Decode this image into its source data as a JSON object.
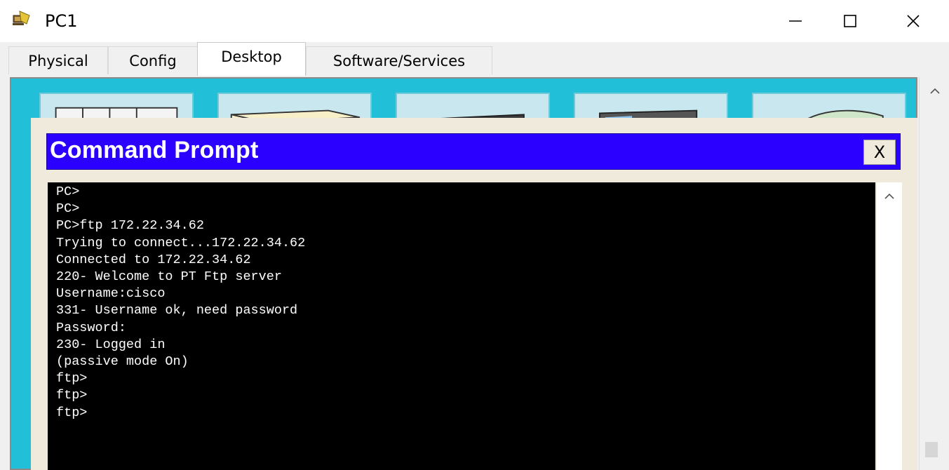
{
  "window": {
    "title": "PC1",
    "icon": "pc-device-icon",
    "controls": [
      "minimize-icon",
      "maximize-icon",
      "close-icon"
    ]
  },
  "tabs": [
    {
      "label": "Physical",
      "active": false
    },
    {
      "label": "Config",
      "active": false
    },
    {
      "label": "Desktop",
      "active": true
    },
    {
      "label": "Software/Services",
      "active": false
    }
  ],
  "colors": {
    "desktop_bg": "#22c0d8",
    "cmd_title_bg": "#2b00ff",
    "terminal_bg": "#000000",
    "terminal_fg": "#ffffff"
  },
  "command_prompt": {
    "title": "Command Prompt",
    "close_label": "X",
    "lines": [
      "PC>",
      "PC>",
      "PC>ftp 172.22.34.62",
      "Trying to connect...172.22.34.62",
      "Connected to 172.22.34.62",
      "220- Welcome to PT Ftp server",
      "Username:cisco",
      "331- Username ok, need password",
      "Password:",
      "230- Logged in",
      "(passive mode On)",
      "ftp>",
      "ftp>",
      "ftp>"
    ]
  }
}
